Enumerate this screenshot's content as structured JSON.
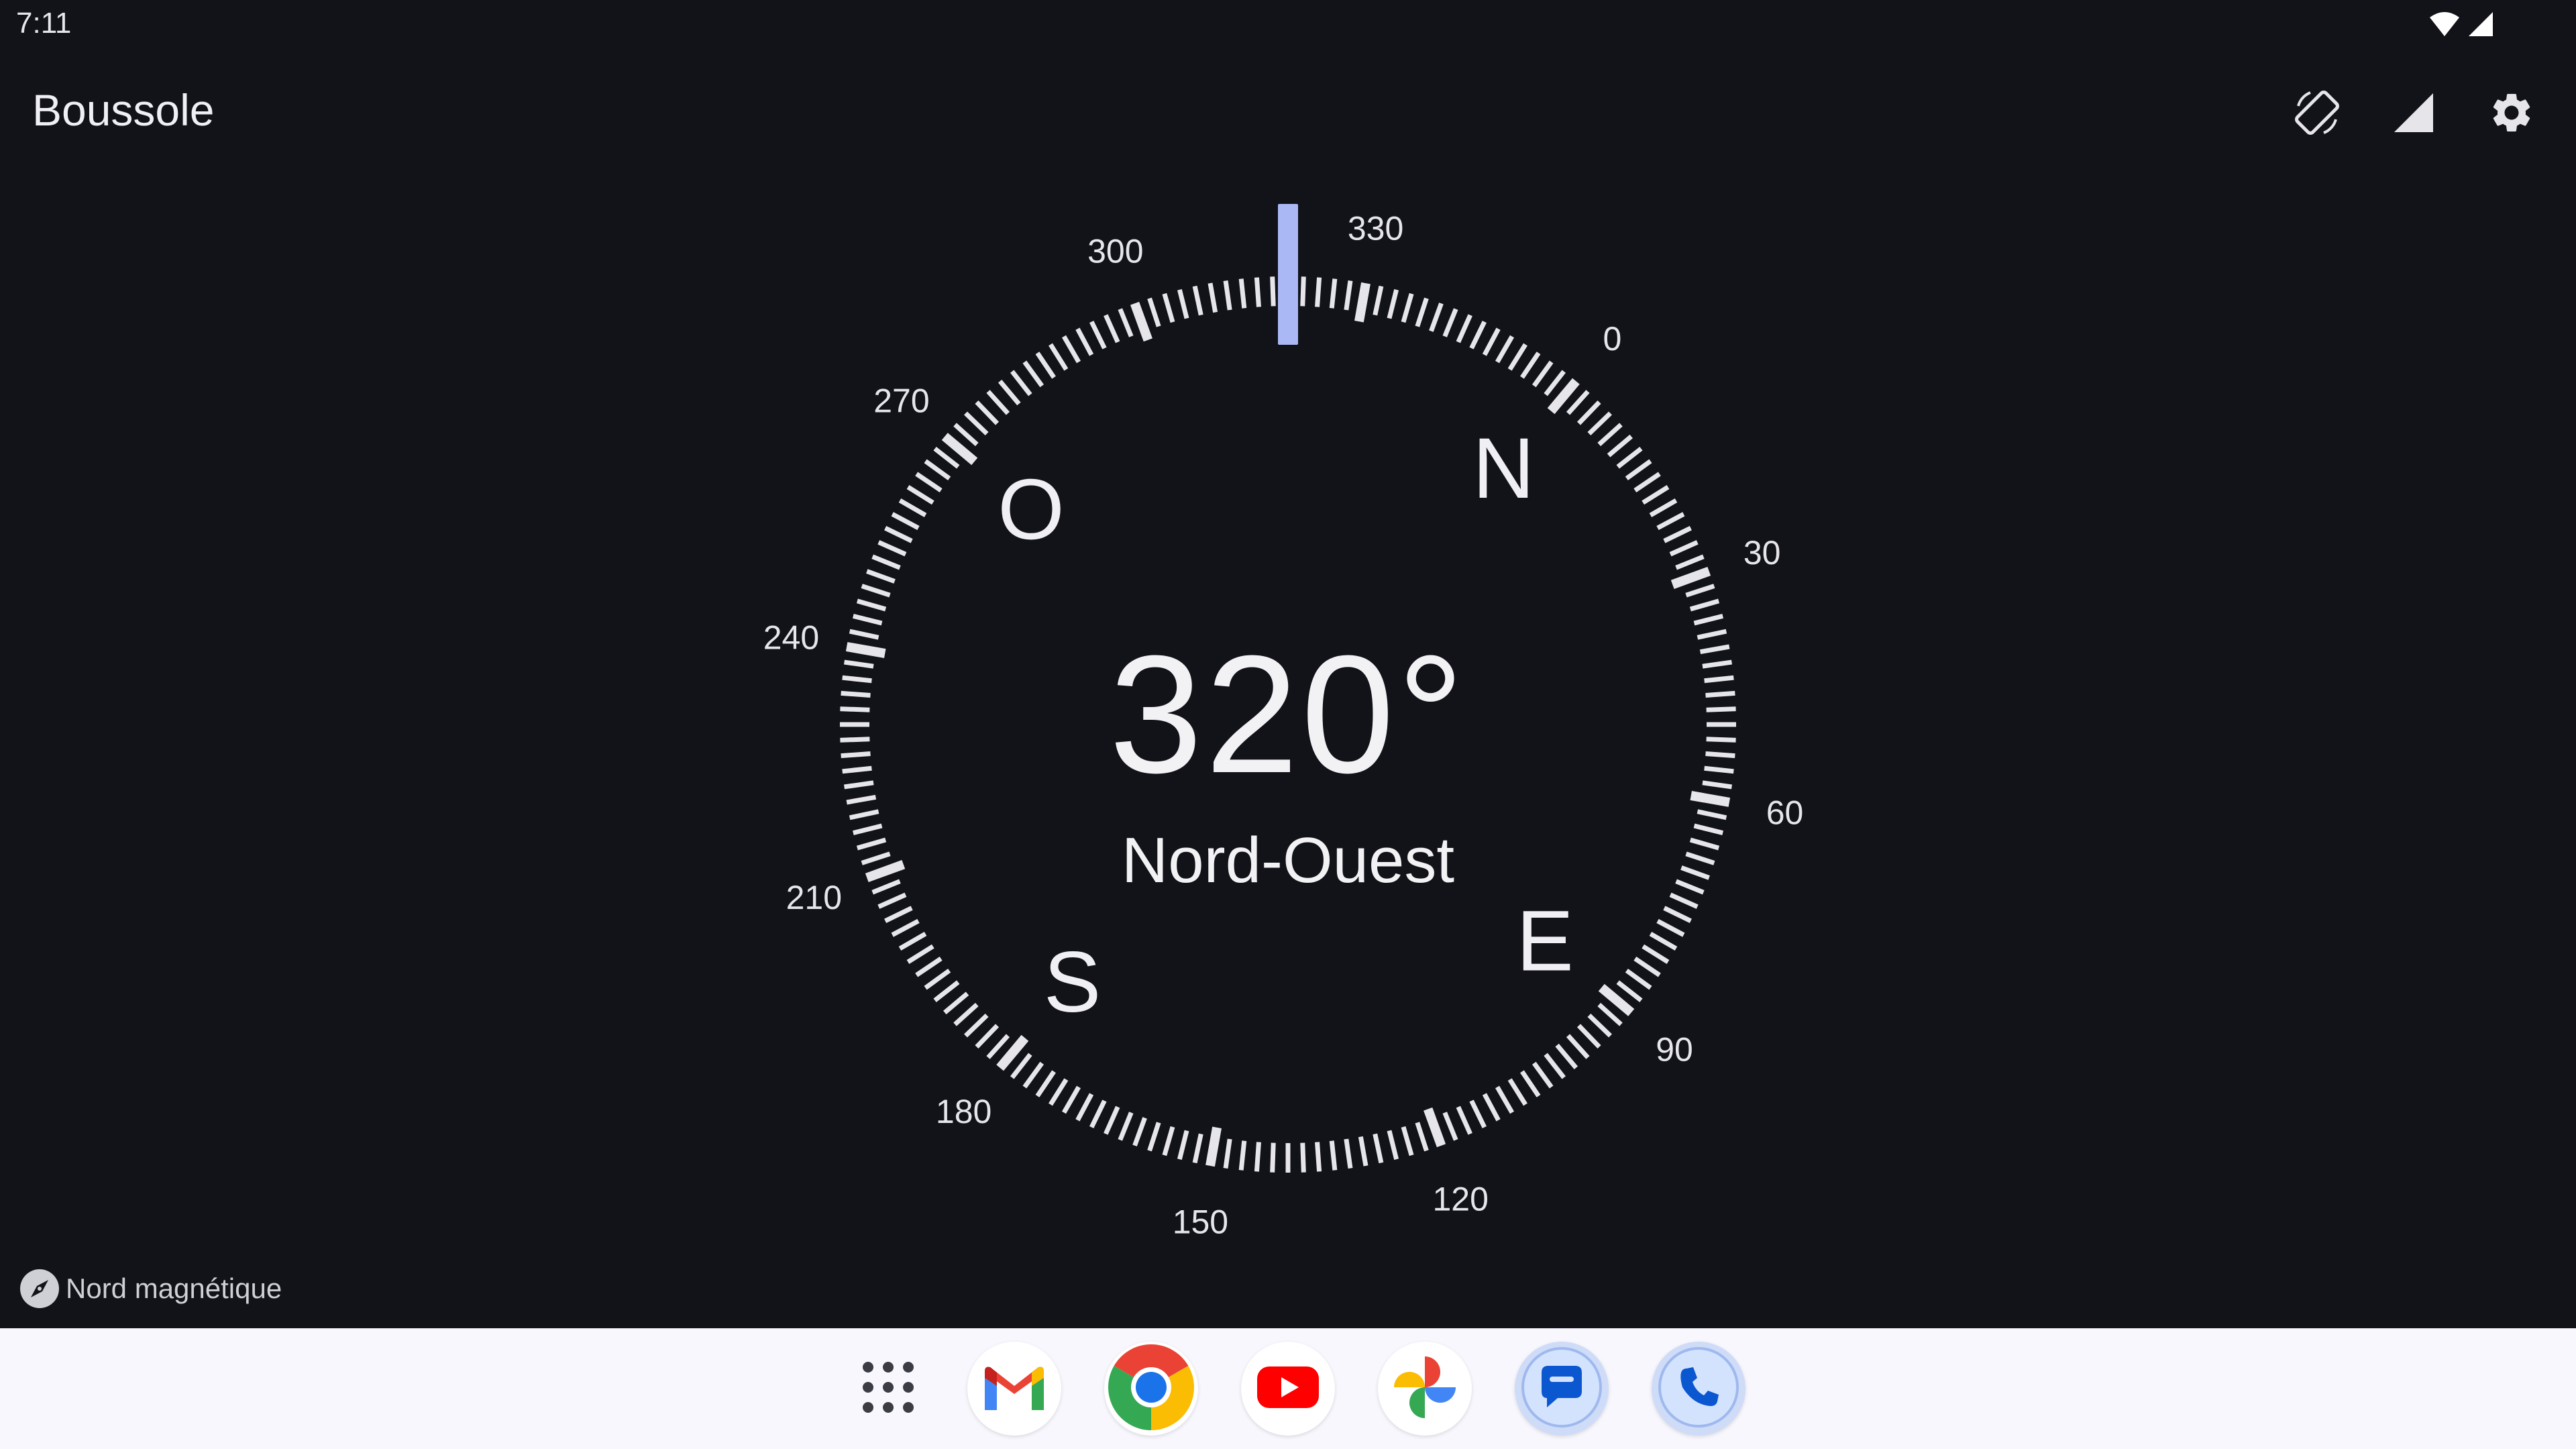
{
  "status_bar": {
    "time": "7:11"
  },
  "app_bar": {
    "title": "Boussole",
    "actions": [
      "screen-rotation-icon",
      "signal-icon",
      "gear-icon"
    ]
  },
  "compass": {
    "heading": "320°",
    "direction": "Nord-Ouest",
    "cardinals": {
      "north": "N",
      "east": "E",
      "south": "S",
      "west": "O"
    },
    "degree_labels": [
      "0",
      "30",
      "60",
      "90",
      "120",
      "150",
      "180",
      "210",
      "240",
      "270",
      "300",
      "330"
    ],
    "heading_degrees": 320,
    "indicator_color": "#aab8f5",
    "tick_color": "#e6e6ea"
  },
  "footer": {
    "magnetic_north_label": "Nord magnétique"
  },
  "dock": {
    "apps": [
      "app-drawer-icon",
      "gmail-icon",
      "chrome-icon",
      "youtube-icon",
      "photos-icon",
      "messages-icon",
      "phone-icon"
    ]
  },
  "colors": {
    "background": "#121319",
    "dock": "#f7f7fd",
    "accent": "#aab8f5"
  }
}
